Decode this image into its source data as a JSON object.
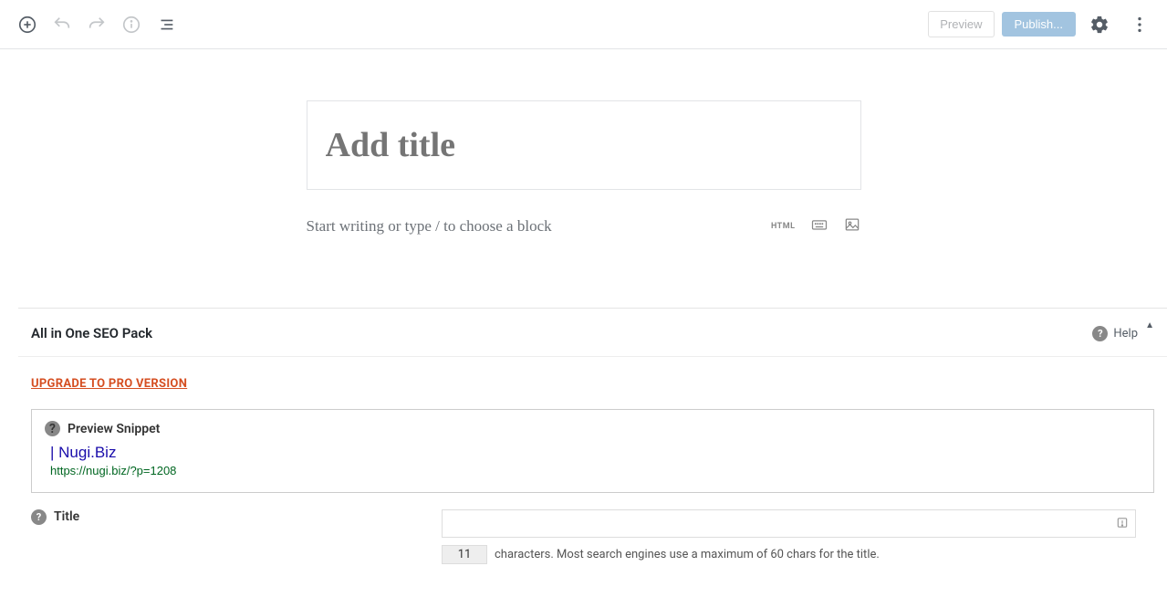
{
  "toolbar": {
    "preview_label": "Preview",
    "publish_label": "Publish..."
  },
  "editor": {
    "title_placeholder": "Add title",
    "content_placeholder": "Start writing or type / to choose a block",
    "html_action": "HTML"
  },
  "seo": {
    "panel_title": "All in One SEO Pack",
    "help_label": "Help",
    "upgrade_text": "UPGRADE TO PRO VERSION",
    "preview_snippet_label": "Preview Snippet",
    "snippet_title": "| Nugi.Biz",
    "snippet_url": "https://nugi.biz/?p=1208",
    "title_label": "Title",
    "title_value": "",
    "char_count": "11",
    "char_hint": "characters. Most search engines use a maximum of 60 chars for the title."
  }
}
